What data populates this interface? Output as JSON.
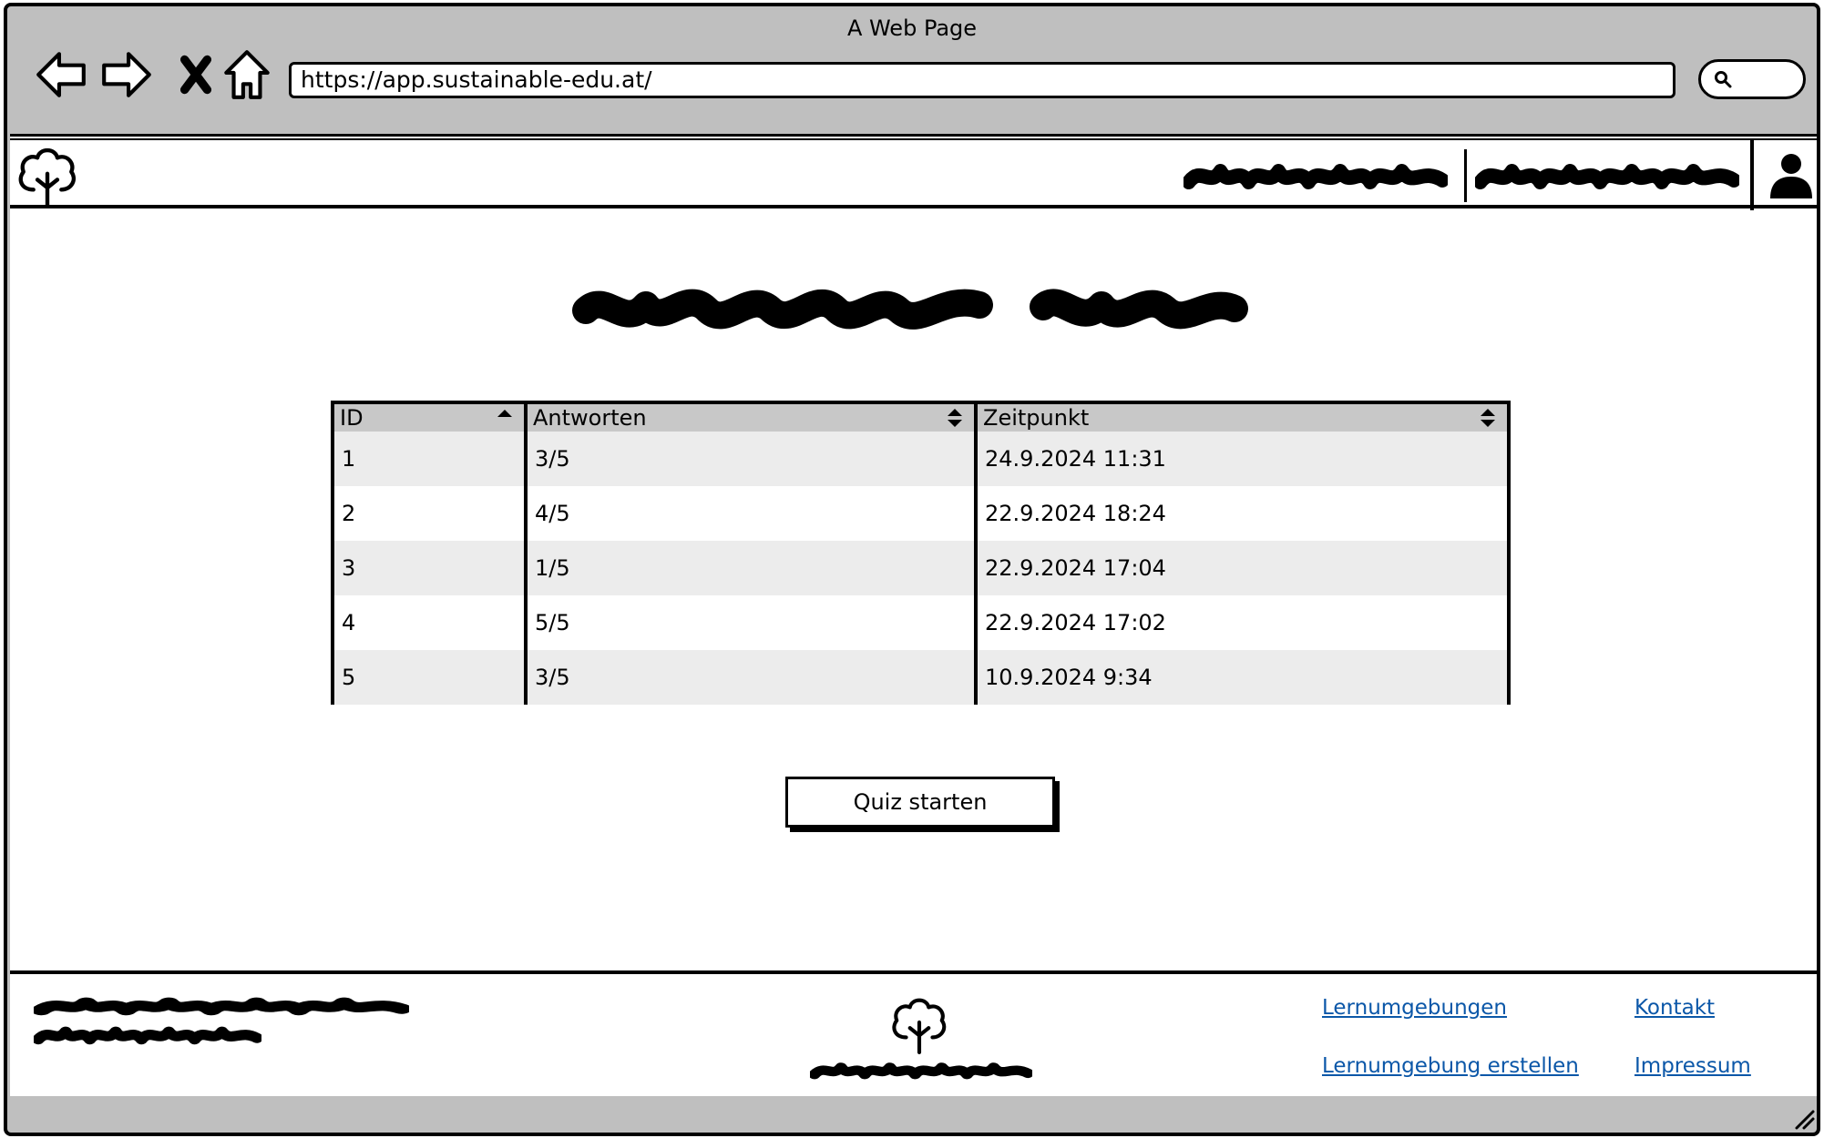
{
  "browser": {
    "title": "A Web Page",
    "url": "https://app.sustainable-edu.at/",
    "nav_icons": [
      "back-arrow-icon",
      "forward-arrow-icon",
      "close-x-icon",
      "home-icon",
      "search-icon"
    ]
  },
  "header": {
    "logo_icon": "tree-logo-icon",
    "account_icon": "user-icon"
  },
  "table": {
    "columns": [
      {
        "label": "ID",
        "sort": "ascending"
      },
      {
        "label": "Antworten",
        "sort": "sortable"
      },
      {
        "label": "Zeitpunkt",
        "sort": "sortable"
      }
    ],
    "rows": [
      {
        "id": "1",
        "answers": "3/5",
        "time": "24.9.2024 11:31"
      },
      {
        "id": "2",
        "answers": "4/5",
        "time": "22.9.2024 18:24"
      },
      {
        "id": "3",
        "answers": "1/5",
        "time": "22.9.2024 17:04"
      },
      {
        "id": "4",
        "answers": "5/5",
        "time": "22.9.2024 17:02"
      },
      {
        "id": "5",
        "answers": "3/5",
        "time": "10.9.2024 9:34"
      }
    ]
  },
  "quiz_button": {
    "label": "Quiz starten"
  },
  "footer": {
    "logo_icon": "tree-logo-icon",
    "links": {
      "lernumgebungen": "Lernumgebungen",
      "erstellen": "Lernumgebung erstellen",
      "kontakt": "Kontakt",
      "impressum": "Impressum"
    }
  },
  "colors": {
    "chrome": "#bfbfbf",
    "header_row": "#c8c8c8",
    "stripe": "#ececec",
    "link": "#0b57a8"
  }
}
